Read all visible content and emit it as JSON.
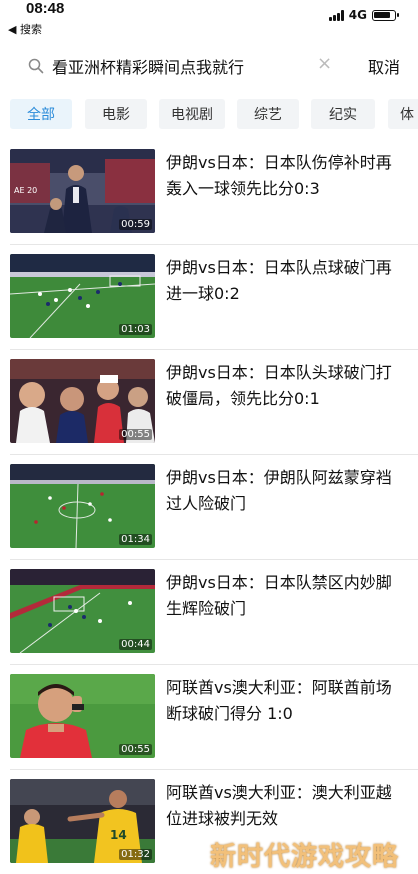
{
  "status": {
    "time": "08:48",
    "back_app": "◀ 搜索",
    "network": "4G"
  },
  "search": {
    "query": "看亚洲杯精彩瞬间点我就行",
    "cancel_label": "取消"
  },
  "tabs": [
    {
      "label": "全部",
      "active": true
    },
    {
      "label": "电影"
    },
    {
      "label": "电视剧"
    },
    {
      "label": "综艺"
    },
    {
      "label": "纪实"
    },
    {
      "label": "体"
    }
  ],
  "videos": [
    {
      "title": "伊朗vs日本：日本队伤停补时再轰入一球领先比分0:3",
      "duration": "00:59"
    },
    {
      "title": "伊朗vs日本：日本队点球破门再进一球0:2",
      "duration": "01:03"
    },
    {
      "title": "伊朗vs日本：日本队头球破门打破僵局，领先比分0:1",
      "duration": "00:55"
    },
    {
      "title": "伊朗vs日本：伊朗队阿兹蒙穿裆过人险破门",
      "duration": "01:34"
    },
    {
      "title": "伊朗vs日本：日本队禁区内妙脚生辉险破门",
      "duration": "00:44"
    },
    {
      "title": "阿联酋vs澳大利亚：阿联酋前场断球破门得分 1:0",
      "duration": "00:55"
    },
    {
      "title": "阿联酋vs澳大利亚：澳大利亚越位进球被判无效",
      "duration": "01:32"
    }
  ],
  "watermark": "新时代游戏攻略",
  "colors": {
    "accent": "#2b8bd9",
    "tab_bg": "#f2f4f6",
    "pitch": "#3f8a3a"
  }
}
